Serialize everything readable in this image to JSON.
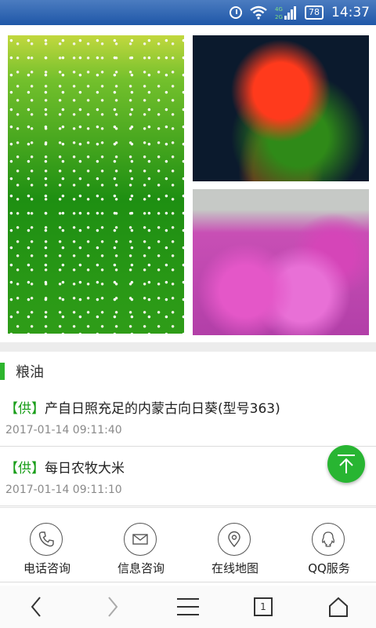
{
  "status_bar": {
    "network_label": "4G 2G",
    "battery": "78",
    "time": "14:37"
  },
  "section": {
    "title": "粮油"
  },
  "items": [
    {
      "tag": "【供】",
      "title": "产自日照充足的内蒙古向日葵(型号363)",
      "date": "2017-01-14 09:11:40"
    },
    {
      "tag": "【供】",
      "title": "每日农牧大米",
      "date": "2017-01-14 09:11:10"
    }
  ],
  "services": [
    {
      "label": "电话咨询",
      "icon": "phone-icon"
    },
    {
      "label": "信息咨询",
      "icon": "mail-icon"
    },
    {
      "label": "在线地图",
      "icon": "map-pin-icon"
    },
    {
      "label": "QQ服务",
      "icon": "qq-icon"
    }
  ],
  "nav": {
    "tab_count": "1"
  },
  "colors": {
    "accent": "#28b532",
    "status_bar": "#1f57a8"
  }
}
